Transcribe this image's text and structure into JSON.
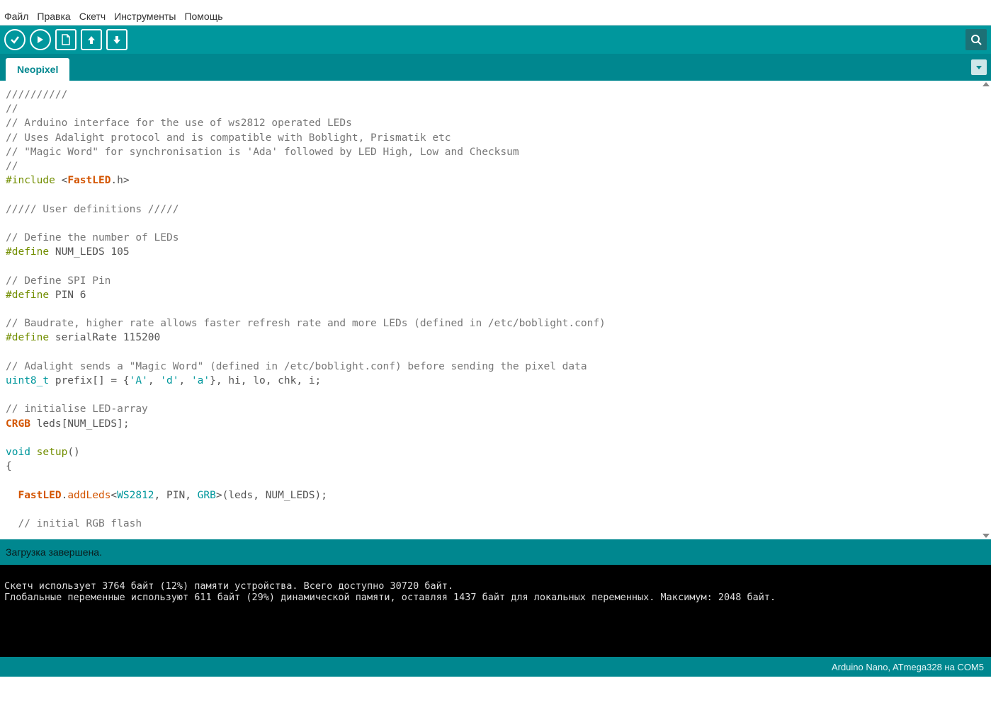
{
  "menu": {
    "items": [
      "Файл",
      "Правка",
      "Скетч",
      "Инструменты",
      "Помощь"
    ]
  },
  "toolbar": {
    "icons": [
      "verify",
      "upload",
      "new",
      "open",
      "save"
    ],
    "serial": "serial-monitor"
  },
  "tabs": {
    "active": "Neopixel"
  },
  "code": {
    "lines": [
      {
        "t": "cm",
        "s": "//////////"
      },
      {
        "t": "cm",
        "s": "//"
      },
      {
        "t": "cm",
        "s": "// Arduino interface for the use of ws2812 operated LEDs"
      },
      {
        "t": "cm",
        "s": "// Uses Adalight protocol and is compatible with Boblight, Prismatik etc"
      },
      {
        "t": "cm",
        "s": "// \"Magic Word\" for synchronisation is 'Ada' followed by LED High, Low and Checksum"
      },
      {
        "t": "cm",
        "s": "//"
      },
      {
        "t": "inc",
        "pre": "#include",
        "lt": "<",
        "cls": "FastLED",
        "rest": ".h>"
      },
      {
        "t": "blank",
        "s": ""
      },
      {
        "t": "cm",
        "s": "///// User definitions /////"
      },
      {
        "t": "blank",
        "s": ""
      },
      {
        "t": "cm",
        "s": "// Define the number of LEDs"
      },
      {
        "t": "def",
        "pre": "#define",
        "rest": " NUM_LEDS 105"
      },
      {
        "t": "blank",
        "s": ""
      },
      {
        "t": "cm",
        "s": "// Define SPI Pin"
      },
      {
        "t": "def",
        "pre": "#define",
        "rest": " PIN 6"
      },
      {
        "t": "blank",
        "s": ""
      },
      {
        "t": "cm",
        "s": "// Baudrate, higher rate allows faster refresh rate and more LEDs (defined in /etc/boblight.conf)"
      },
      {
        "t": "def",
        "pre": "#define",
        "rest": " serialRate 115200"
      },
      {
        "t": "blank",
        "s": ""
      },
      {
        "t": "cm",
        "s": "// Adalight sends a \"Magic Word\" (defined in /etc/boblight.conf) before sending the pixel data"
      },
      {
        "t": "decl",
        "type": "uint8_t",
        "rest1": " prefix[] = {",
        "s1": "'A'",
        "c1": ", ",
        "s2": "'d'",
        "c2": ", ",
        "s3": "'a'",
        "rest2": "}, hi, lo, chk, i;"
      },
      {
        "t": "blank",
        "s": ""
      },
      {
        "t": "cm",
        "s": "// initialise LED-array"
      },
      {
        "t": "crgb",
        "cls": "CRGB",
        "rest": " leds[NUM_LEDS];"
      },
      {
        "t": "blank",
        "s": ""
      },
      {
        "t": "func",
        "type": "void",
        "name": " setup",
        "rest": "()"
      },
      {
        "t": "plain",
        "s": "{"
      },
      {
        "t": "blank",
        "s": ""
      },
      {
        "t": "fast",
        "indent": "  ",
        "cls": "FastLED",
        "dot": ".",
        "meth": "addLeds",
        "lt": "<",
        "c1": "WS2812",
        "mid": ", PIN, ",
        "c2": "GRB",
        "gt": ">",
        "rest": "(leds, NUM_LEDS);"
      },
      {
        "t": "blank",
        "s": ""
      },
      {
        "t": "cm",
        "s": "  // initial RGB flash"
      }
    ]
  },
  "status": {
    "text": "Загрузка завершена."
  },
  "console": {
    "line1": "Скетч использует 3764 байт (12%) памяти устройства. Всего доступно 30720 байт.",
    "line2": "Глобальные переменные используют 611 байт (29%) динамической памяти, оставляя 1437 байт для локальных переменных. Максимум: 2048 байт."
  },
  "footer": {
    "board": "Arduino Nano, ATmega328 на COM5"
  }
}
